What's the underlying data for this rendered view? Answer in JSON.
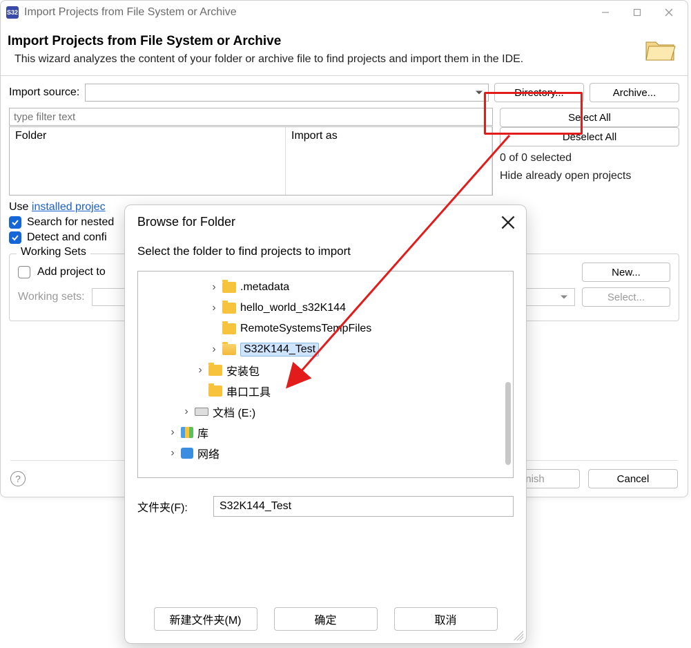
{
  "window": {
    "title": "Import Projects from File System or Archive",
    "header_title": "Import Projects from File System or Archive",
    "header_desc": "This wizard analyzes the content of your folder or archive file to find projects and import them in the IDE."
  },
  "import": {
    "source_label": "Import source:",
    "source_value": "",
    "directory_btn": "Directory...",
    "archive_btn": "Archive...",
    "filter_placeholder": "type filter text",
    "col_folder": "Folder",
    "col_import_as": "Import as",
    "select_all": "Select All",
    "deselect_all": "Deselect All",
    "selected_count": "0 of 0 selected",
    "hide_already_open": "Hide already open projects",
    "hide_already_open_checked": false
  },
  "links": {
    "prefix": "Use ",
    "link_text": "installed projec"
  },
  "options": {
    "search_nested": "Search for nested",
    "search_nested_checked": true,
    "detect_configure": "Detect and confi",
    "detect_configure_checked": true
  },
  "working_sets": {
    "legend": "Working Sets",
    "add_label": "Add project to",
    "add_checked": false,
    "ws_label": "Working sets:",
    "new_btn": "New...",
    "select_btn": "Select..."
  },
  "footer": {
    "finish": "nish",
    "cancel": "Cancel"
  },
  "dialog": {
    "title": "Browse for Folder",
    "subtitle": "Select the folder to find projects to import",
    "tree": [
      {
        "indent": 5,
        "expander": ">",
        "icon": "folder",
        "label": ".metadata"
      },
      {
        "indent": 5,
        "expander": ">",
        "icon": "folder",
        "label": "hello_world_s32K144"
      },
      {
        "indent": 5,
        "expander": "",
        "icon": "folder",
        "label": "RemoteSystemsTempFiles"
      },
      {
        "indent": 5,
        "expander": ">",
        "icon": "folder-open",
        "label": "S32K144_Test",
        "selected": true
      },
      {
        "indent": 4,
        "expander": ">",
        "icon": "folder",
        "label": "安装包"
      },
      {
        "indent": 4,
        "expander": "",
        "icon": "folder",
        "label": "串口工具"
      },
      {
        "indent": 3,
        "expander": ">",
        "icon": "drive",
        "label": "文档 (E:)"
      },
      {
        "indent": 2,
        "expander": ">",
        "icon": "lib",
        "label": "库"
      },
      {
        "indent": 2,
        "expander": ">",
        "icon": "net",
        "label": "网络"
      }
    ],
    "folder_label": "文件夹(F):",
    "folder_value": "S32K144_Test",
    "new_folder": "新建文件夹(M)",
    "ok": "确定",
    "cancel": "取消"
  }
}
